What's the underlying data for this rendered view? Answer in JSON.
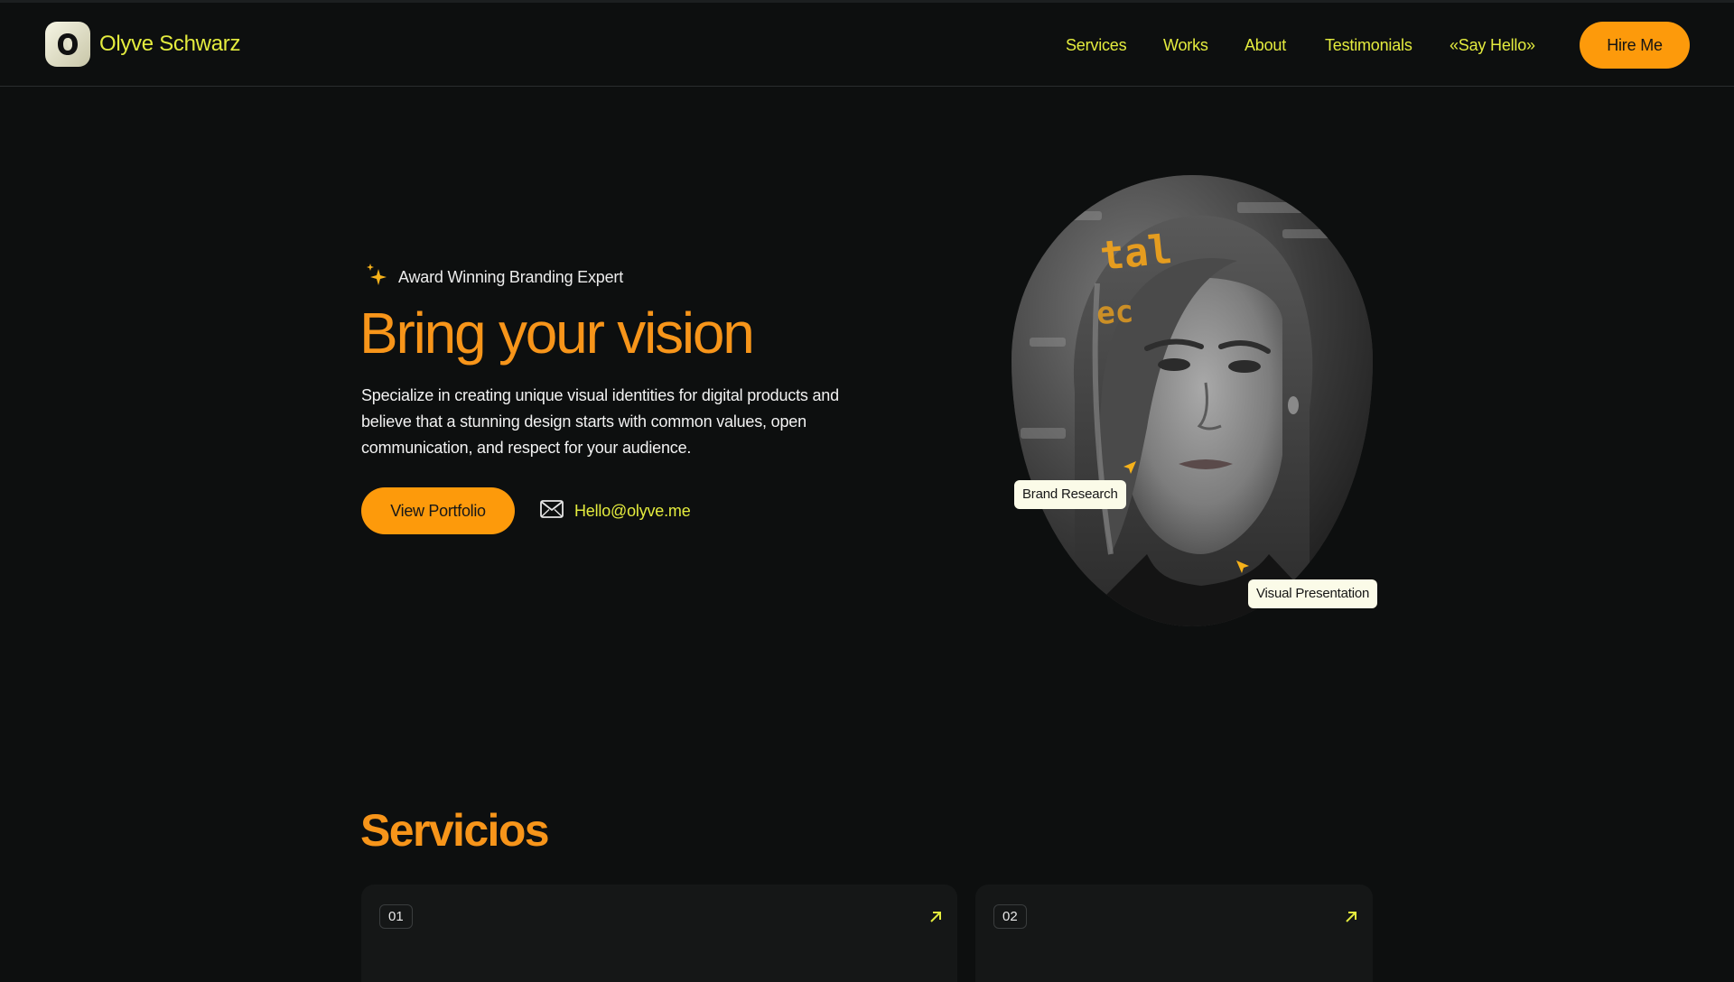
{
  "header": {
    "brand_name": "Olyve Schwarz",
    "nav": [
      {
        "label": "Services"
      },
      {
        "label": "Works"
      },
      {
        "label": "About"
      },
      {
        "label": "Testimonials"
      },
      {
        "label": "«Say Hello»"
      }
    ],
    "cta_label": "Hire Me"
  },
  "hero": {
    "badge": "Award Winning Branding Expert",
    "title": "Bring your vision",
    "description": "Specialize in creating unique visual identities for digital products and believe that a stunning design starts with common values, open communication, and respect for your audience.",
    "primary_button": "View Portfolio",
    "email": "Hello@olyve.me",
    "tags": [
      "Brand Research",
      "Visual Presentation"
    ]
  },
  "services": {
    "title": "Servicios",
    "cards": [
      {
        "number": "01"
      },
      {
        "number": "02"
      }
    ]
  },
  "colors": {
    "background": "#0d0f0f",
    "accent_orange": "#fd9a0b",
    "accent_yellow": "#e4ec3e",
    "card": "#151717"
  },
  "icons": {
    "logo": "logo-icon",
    "badge": "sparkle-icon",
    "email": "mail-icon",
    "card_action": "arrow-up-right-icon",
    "tag_pointer": "cursor-pointer-icon"
  }
}
